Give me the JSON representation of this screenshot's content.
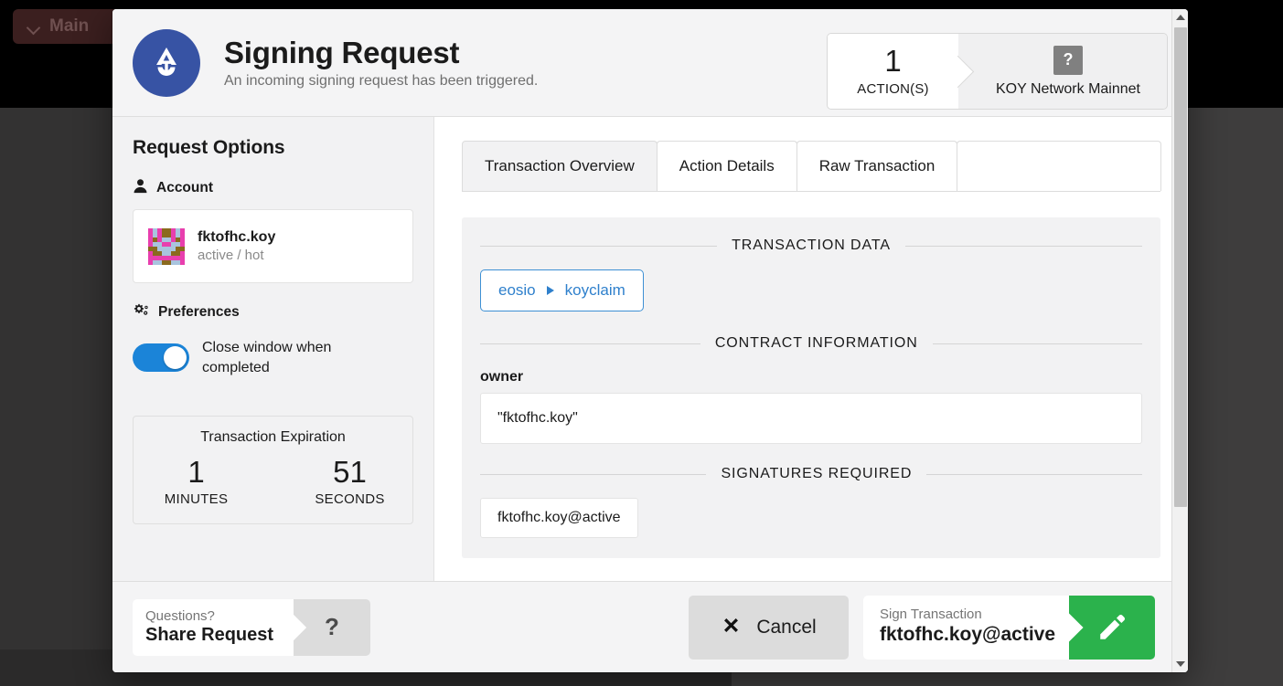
{
  "background": {
    "network_button_label": "Main",
    "network_button_icon": "chevron-down-icon"
  },
  "header": {
    "logo_icon": "anchor-a-logo-icon",
    "title": "Signing Request",
    "subtitle": "An incoming signing request has been triggered.",
    "badges": {
      "actions_count": "1",
      "actions_label": "ACTION(S)",
      "network_icon": "?",
      "network_label": "KOY Network Mainnet"
    }
  },
  "sidebar": {
    "title": "Request Options",
    "account_section": {
      "icon": "person-icon",
      "label": "Account",
      "account_name": "fktofhc.koy",
      "account_permission": "active / hot",
      "avatar_icon": "identicon-avatar"
    },
    "preferences_section": {
      "icon": "gears-icon",
      "label": "Preferences",
      "toggle_label": "Close window when completed",
      "toggle_state": "on"
    },
    "expiration": {
      "title": "Transaction Expiration",
      "minutes_value": "1",
      "minutes_label": "MINUTES",
      "seconds_value": "51",
      "seconds_label": "SECONDS"
    }
  },
  "content": {
    "tabs": [
      {
        "label": "Transaction Overview",
        "active": true
      },
      {
        "label": "Action Details",
        "active": false
      },
      {
        "label": "Raw Transaction",
        "active": false
      }
    ],
    "transaction_data_heading": "TRANSACTION DATA",
    "action_pill": {
      "contract": "eosio",
      "arrow_icon": "triangle-right-icon",
      "action": "koyclaim"
    },
    "contract_information_heading": "CONTRACT INFORMATION",
    "field_label": "owner",
    "field_value": "\"fktofhc.koy\"",
    "signatures_required_heading": "SIGNATURES REQUIRED",
    "signature_chip": "fktofhc.koy@active"
  },
  "footer": {
    "share": {
      "small_label": "Questions?",
      "big_label": "Share Request",
      "help_icon": "?"
    },
    "cancel": {
      "icon": "close-x-icon",
      "label": "Cancel"
    },
    "sign": {
      "small_label": "Sign Transaction",
      "big_label": "fktofhc.koy@active",
      "icon": "pencil-icon"
    }
  },
  "scrollbar": {
    "up_icon": "triangle-up-icon",
    "down_icon": "triangle-down-icon"
  },
  "colors": {
    "brand_blue": "#3753a4",
    "accent_blue": "#2f80cc",
    "toggle_blue": "#1b84d8",
    "sign_green": "#2bb24c",
    "panel_gray": "#f2f2f3",
    "background_dark": "#3b3a3a"
  }
}
